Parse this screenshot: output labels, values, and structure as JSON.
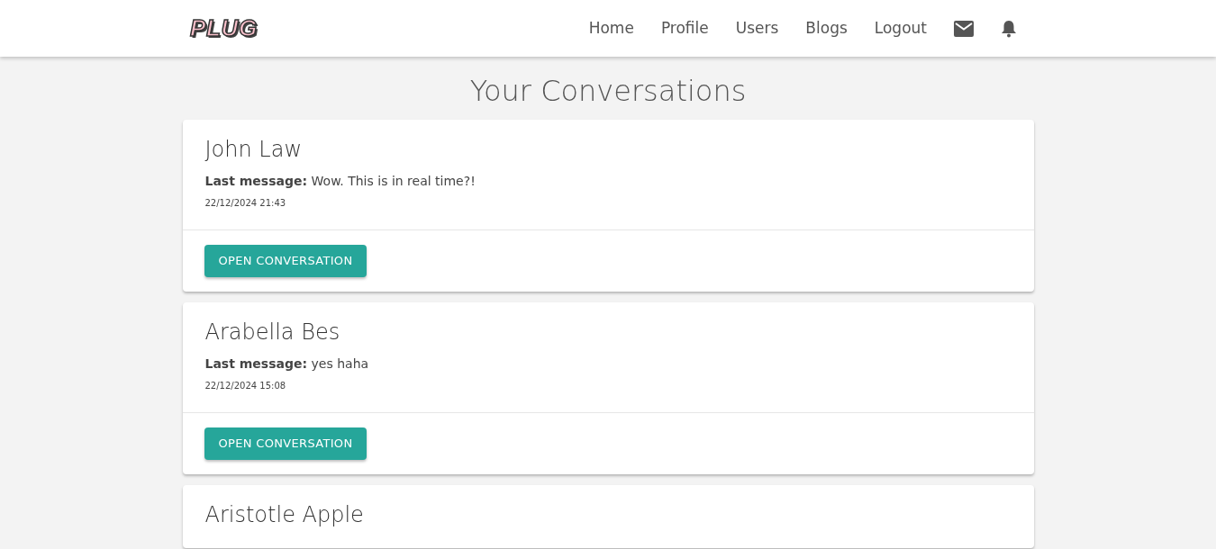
{
  "navbar": {
    "logo": "PLUG",
    "links": [
      "Home",
      "Profile",
      "Users",
      "Blogs",
      "Logout"
    ]
  },
  "page_title": "Your Conversations",
  "conversations": [
    {
      "name": "John Law",
      "last_message": "**Last message:** Wow. This is in real time?!",
      "timestamp": "22/12/2024 21:43",
      "action": "OPEN CONVERSATION"
    },
    {
      "name": "Arabella Bes",
      "last_message": "**Last message:** yes haha",
      "timestamp": "22/12/2024 15:08",
      "action": "OPEN CONVERSATION"
    },
    {
      "name": "Aristotle Apple"
    }
  ]
}
